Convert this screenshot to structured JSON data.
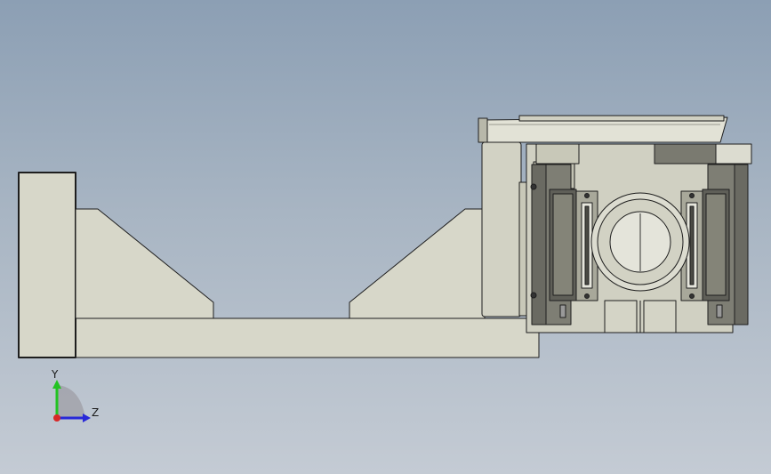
{
  "triad": {
    "y_label": "Y",
    "z_label": "Z"
  },
  "colors": {
    "part_light": "#d7d7c9",
    "part_mid": "#c4c4b4",
    "part_dark": "#7a7a70",
    "edge": "#1e1e1e",
    "axis_y": "#22c322",
    "axis_z": "#2828d8",
    "axis_x": "#d82828"
  }
}
